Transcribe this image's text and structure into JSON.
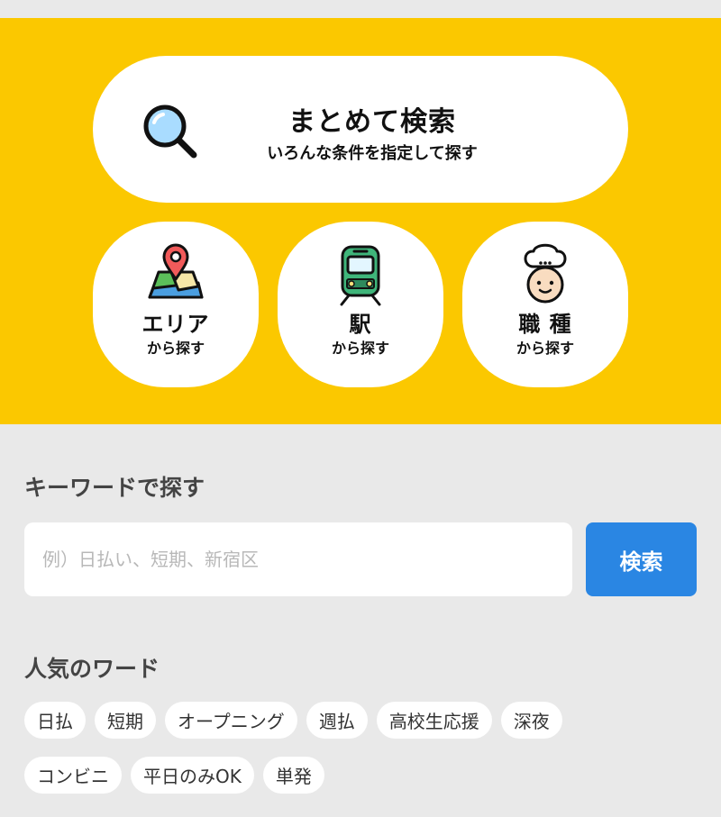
{
  "hero": {
    "main_search": {
      "title": "まとめて検索",
      "subtitle": "いろんな条件を指定して探す",
      "icon": "magnifier-icon"
    },
    "categories": [
      {
        "label": "エリア",
        "sub": "から探す",
        "icon": "map-pin-icon"
      },
      {
        "label": "駅",
        "sub": "から探す",
        "icon": "train-icon"
      },
      {
        "label": "職 種",
        "sub": "から探す",
        "icon": "chef-icon"
      }
    ]
  },
  "keyword": {
    "title": "キーワードで探す",
    "placeholder": "例）日払い、短期、新宿区",
    "value": "",
    "button_label": "検索"
  },
  "popular": {
    "title": "人気のワード",
    "row1": [
      "日払",
      "短期",
      "オープニング",
      "週払",
      "高校生応援",
      "深夜"
    ],
    "row2": [
      "コンビニ",
      "平日のみOK",
      "単発"
    ]
  },
  "colors": {
    "hero_bg": "#fbc800",
    "button": "#2a86e3",
    "page_bg": "#e9e9e9"
  }
}
